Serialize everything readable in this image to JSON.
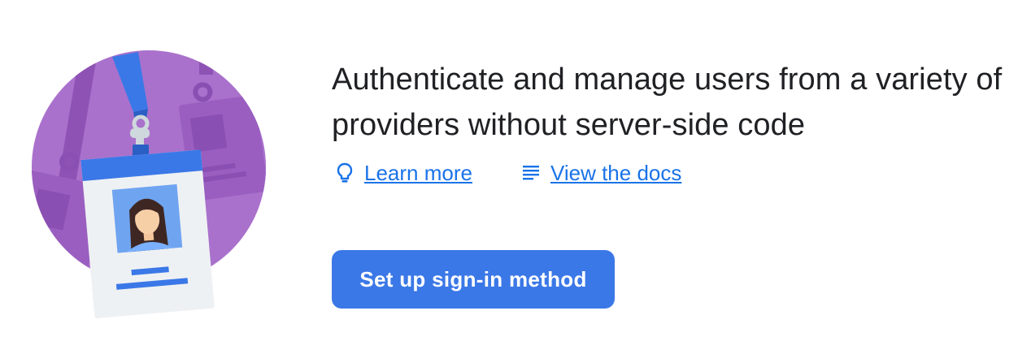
{
  "hero": {
    "headline": "Authenticate and manage users from a variety of providers without server-side code",
    "illustration_icon": "id-badge-illustration"
  },
  "links": [
    {
      "label": "Learn more",
      "icon": "lightbulb-icon"
    },
    {
      "label": "View the docs",
      "icon": "docs-lines-icon"
    }
  ],
  "cta": {
    "label": "Set up sign-in method"
  },
  "colors": {
    "accent": "#1a73e8",
    "button": "#3b78e7",
    "headline": "#202124",
    "illustration_purple": "#a56cc8"
  }
}
